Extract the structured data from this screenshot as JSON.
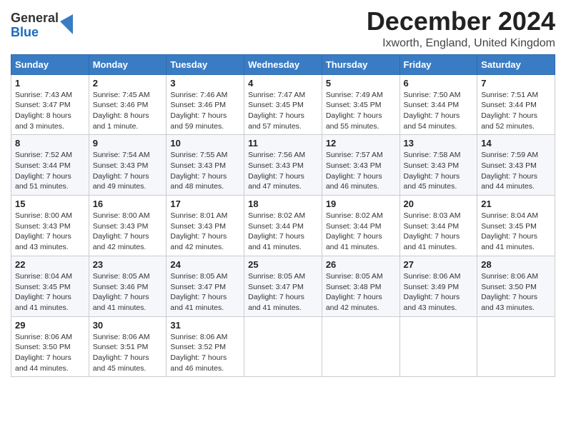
{
  "logo": {
    "general": "General",
    "blue": "Blue"
  },
  "header": {
    "month_title": "December 2024",
    "location": "Ixworth, England, United Kingdom"
  },
  "weekdays": [
    "Sunday",
    "Monday",
    "Tuesday",
    "Wednesday",
    "Thursday",
    "Friday",
    "Saturday"
  ],
  "weeks": [
    [
      {
        "day": "1",
        "sunrise": "Sunrise: 7:43 AM",
        "sunset": "Sunset: 3:47 PM",
        "daylight": "Daylight: 8 hours and 3 minutes."
      },
      {
        "day": "2",
        "sunrise": "Sunrise: 7:45 AM",
        "sunset": "Sunset: 3:46 PM",
        "daylight": "Daylight: 8 hours and 1 minute."
      },
      {
        "day": "3",
        "sunrise": "Sunrise: 7:46 AM",
        "sunset": "Sunset: 3:46 PM",
        "daylight": "Daylight: 7 hours and 59 minutes."
      },
      {
        "day": "4",
        "sunrise": "Sunrise: 7:47 AM",
        "sunset": "Sunset: 3:45 PM",
        "daylight": "Daylight: 7 hours and 57 minutes."
      },
      {
        "day": "5",
        "sunrise": "Sunrise: 7:49 AM",
        "sunset": "Sunset: 3:45 PM",
        "daylight": "Daylight: 7 hours and 55 minutes."
      },
      {
        "day": "6",
        "sunrise": "Sunrise: 7:50 AM",
        "sunset": "Sunset: 3:44 PM",
        "daylight": "Daylight: 7 hours and 54 minutes."
      },
      {
        "day": "7",
        "sunrise": "Sunrise: 7:51 AM",
        "sunset": "Sunset: 3:44 PM",
        "daylight": "Daylight: 7 hours and 52 minutes."
      }
    ],
    [
      {
        "day": "8",
        "sunrise": "Sunrise: 7:52 AM",
        "sunset": "Sunset: 3:44 PM",
        "daylight": "Daylight: 7 hours and 51 minutes."
      },
      {
        "day": "9",
        "sunrise": "Sunrise: 7:54 AM",
        "sunset": "Sunset: 3:43 PM",
        "daylight": "Daylight: 7 hours and 49 minutes."
      },
      {
        "day": "10",
        "sunrise": "Sunrise: 7:55 AM",
        "sunset": "Sunset: 3:43 PM",
        "daylight": "Daylight: 7 hours and 48 minutes."
      },
      {
        "day": "11",
        "sunrise": "Sunrise: 7:56 AM",
        "sunset": "Sunset: 3:43 PM",
        "daylight": "Daylight: 7 hours and 47 minutes."
      },
      {
        "day": "12",
        "sunrise": "Sunrise: 7:57 AM",
        "sunset": "Sunset: 3:43 PM",
        "daylight": "Daylight: 7 hours and 46 minutes."
      },
      {
        "day": "13",
        "sunrise": "Sunrise: 7:58 AM",
        "sunset": "Sunset: 3:43 PM",
        "daylight": "Daylight: 7 hours and 45 minutes."
      },
      {
        "day": "14",
        "sunrise": "Sunrise: 7:59 AM",
        "sunset": "Sunset: 3:43 PM",
        "daylight": "Daylight: 7 hours and 44 minutes."
      }
    ],
    [
      {
        "day": "15",
        "sunrise": "Sunrise: 8:00 AM",
        "sunset": "Sunset: 3:43 PM",
        "daylight": "Daylight: 7 hours and 43 minutes."
      },
      {
        "day": "16",
        "sunrise": "Sunrise: 8:00 AM",
        "sunset": "Sunset: 3:43 PM",
        "daylight": "Daylight: 7 hours and 42 minutes."
      },
      {
        "day": "17",
        "sunrise": "Sunrise: 8:01 AM",
        "sunset": "Sunset: 3:43 PM",
        "daylight": "Daylight: 7 hours and 42 minutes."
      },
      {
        "day": "18",
        "sunrise": "Sunrise: 8:02 AM",
        "sunset": "Sunset: 3:44 PM",
        "daylight": "Daylight: 7 hours and 41 minutes."
      },
      {
        "day": "19",
        "sunrise": "Sunrise: 8:02 AM",
        "sunset": "Sunset: 3:44 PM",
        "daylight": "Daylight: 7 hours and 41 minutes."
      },
      {
        "day": "20",
        "sunrise": "Sunrise: 8:03 AM",
        "sunset": "Sunset: 3:44 PM",
        "daylight": "Daylight: 7 hours and 41 minutes."
      },
      {
        "day": "21",
        "sunrise": "Sunrise: 8:04 AM",
        "sunset": "Sunset: 3:45 PM",
        "daylight": "Daylight: 7 hours and 41 minutes."
      }
    ],
    [
      {
        "day": "22",
        "sunrise": "Sunrise: 8:04 AM",
        "sunset": "Sunset: 3:45 PM",
        "daylight": "Daylight: 7 hours and 41 minutes."
      },
      {
        "day": "23",
        "sunrise": "Sunrise: 8:05 AM",
        "sunset": "Sunset: 3:46 PM",
        "daylight": "Daylight: 7 hours and 41 minutes."
      },
      {
        "day": "24",
        "sunrise": "Sunrise: 8:05 AM",
        "sunset": "Sunset: 3:47 PM",
        "daylight": "Daylight: 7 hours and 41 minutes."
      },
      {
        "day": "25",
        "sunrise": "Sunrise: 8:05 AM",
        "sunset": "Sunset: 3:47 PM",
        "daylight": "Daylight: 7 hours and 41 minutes."
      },
      {
        "day": "26",
        "sunrise": "Sunrise: 8:05 AM",
        "sunset": "Sunset: 3:48 PM",
        "daylight": "Daylight: 7 hours and 42 minutes."
      },
      {
        "day": "27",
        "sunrise": "Sunrise: 8:06 AM",
        "sunset": "Sunset: 3:49 PM",
        "daylight": "Daylight: 7 hours and 43 minutes."
      },
      {
        "day": "28",
        "sunrise": "Sunrise: 8:06 AM",
        "sunset": "Sunset: 3:50 PM",
        "daylight": "Daylight: 7 hours and 43 minutes."
      }
    ],
    [
      {
        "day": "29",
        "sunrise": "Sunrise: 8:06 AM",
        "sunset": "Sunset: 3:50 PM",
        "daylight": "Daylight: 7 hours and 44 minutes."
      },
      {
        "day": "30",
        "sunrise": "Sunrise: 8:06 AM",
        "sunset": "Sunset: 3:51 PM",
        "daylight": "Daylight: 7 hours and 45 minutes."
      },
      {
        "day": "31",
        "sunrise": "Sunrise: 8:06 AM",
        "sunset": "Sunset: 3:52 PM",
        "daylight": "Daylight: 7 hours and 46 minutes."
      },
      null,
      null,
      null,
      null
    ]
  ]
}
